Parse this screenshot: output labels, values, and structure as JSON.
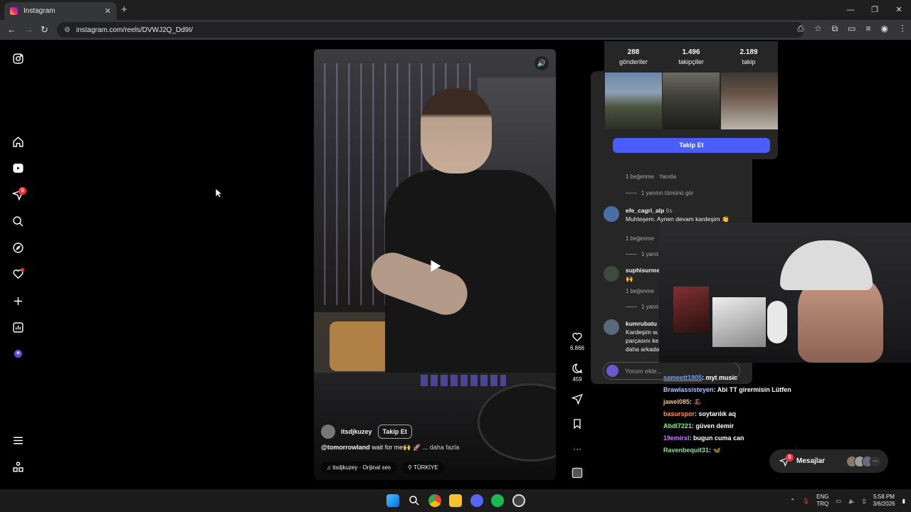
{
  "browser": {
    "tab_title": "Instagram",
    "url": "instagram.com/reels/DVWJ2Q_Dd9I/"
  },
  "sidebar": {
    "notifications_badge": "8"
  },
  "reel": {
    "owner": "itsdjkuzey",
    "follow_label": "Takip Et",
    "caption_mention": "@tomorrowland",
    "caption_text": " wait for me🙌 🚀 ... ",
    "caption_more": "daha fazla",
    "audio": "♫ itsdjkuzey · Orijinal ses",
    "location": "⚲ TÜRKİYE",
    "likes": "6.866",
    "comments_count": "459"
  },
  "hovercard": {
    "posts_count": "288",
    "posts_label": "gönderiler",
    "followers_count": "1.496",
    "followers_label": "takipçiler",
    "following_count": "2.189",
    "following_label": "takip",
    "follow_button": "Takip Et"
  },
  "comments": {
    "items": [
      {
        "name": "efe_cagri_alp",
        "time": "6s",
        "text": "Muhteşem. Aynen devam kardeşim 👏",
        "likes": "1 beğenme"
      },
      {
        "name": "suphisurme",
        "time": "",
        "text": "🙌",
        "likes": "1 beğenme"
      },
      {
        "name": "kumrubatu",
        "time": "",
        "text": "Kardeşim w... parçasını ke... daha arkada...",
        "likes": ""
      }
    ],
    "first_likes": "1 beğenme",
    "reply_label": "Yanıtla",
    "view_replies": "1 yanıtın tümünü gör",
    "view_replies_short": "1 yanıt",
    "input_placeholder": "Yorum ekle..."
  },
  "chat": [
    {
      "user": "sameett1905",
      "color": "#6aa0ff",
      "msg": ": myt music"
    },
    {
      "user": "Brawlassisteyen",
      "color": "#b0c4ff",
      "msg": ": Abi TT girermisin Lütfen"
    },
    {
      "user": "jawel085",
      "color": "#f0c27a",
      "msg": ": 🎩"
    },
    {
      "user": "basurspor",
      "color": "#ff9a4a",
      "msg": ": soytarılık aq"
    },
    {
      "user": "Abdl7221",
      "color": "#7dff7d",
      "msg": ": güven demir"
    },
    {
      "user": "19emirxl",
      "color": "#c77dff",
      "msg": ": bugun cuma can"
    },
    {
      "user": "Ravenbequit31",
      "color": "#8fe58f",
      "msg": ": 🦋"
    }
  ],
  "messages": {
    "label": "Mesajlar",
    "badge": "5"
  },
  "taskbar": {
    "lang_top": "ENG",
    "lang_bottom": "TRQ",
    "time": "5:58 PM",
    "date": "3/6/2026"
  },
  "colors": {
    "accent": "#4a5df9",
    "badge": "#ff3040",
    "panel": "#262626"
  }
}
